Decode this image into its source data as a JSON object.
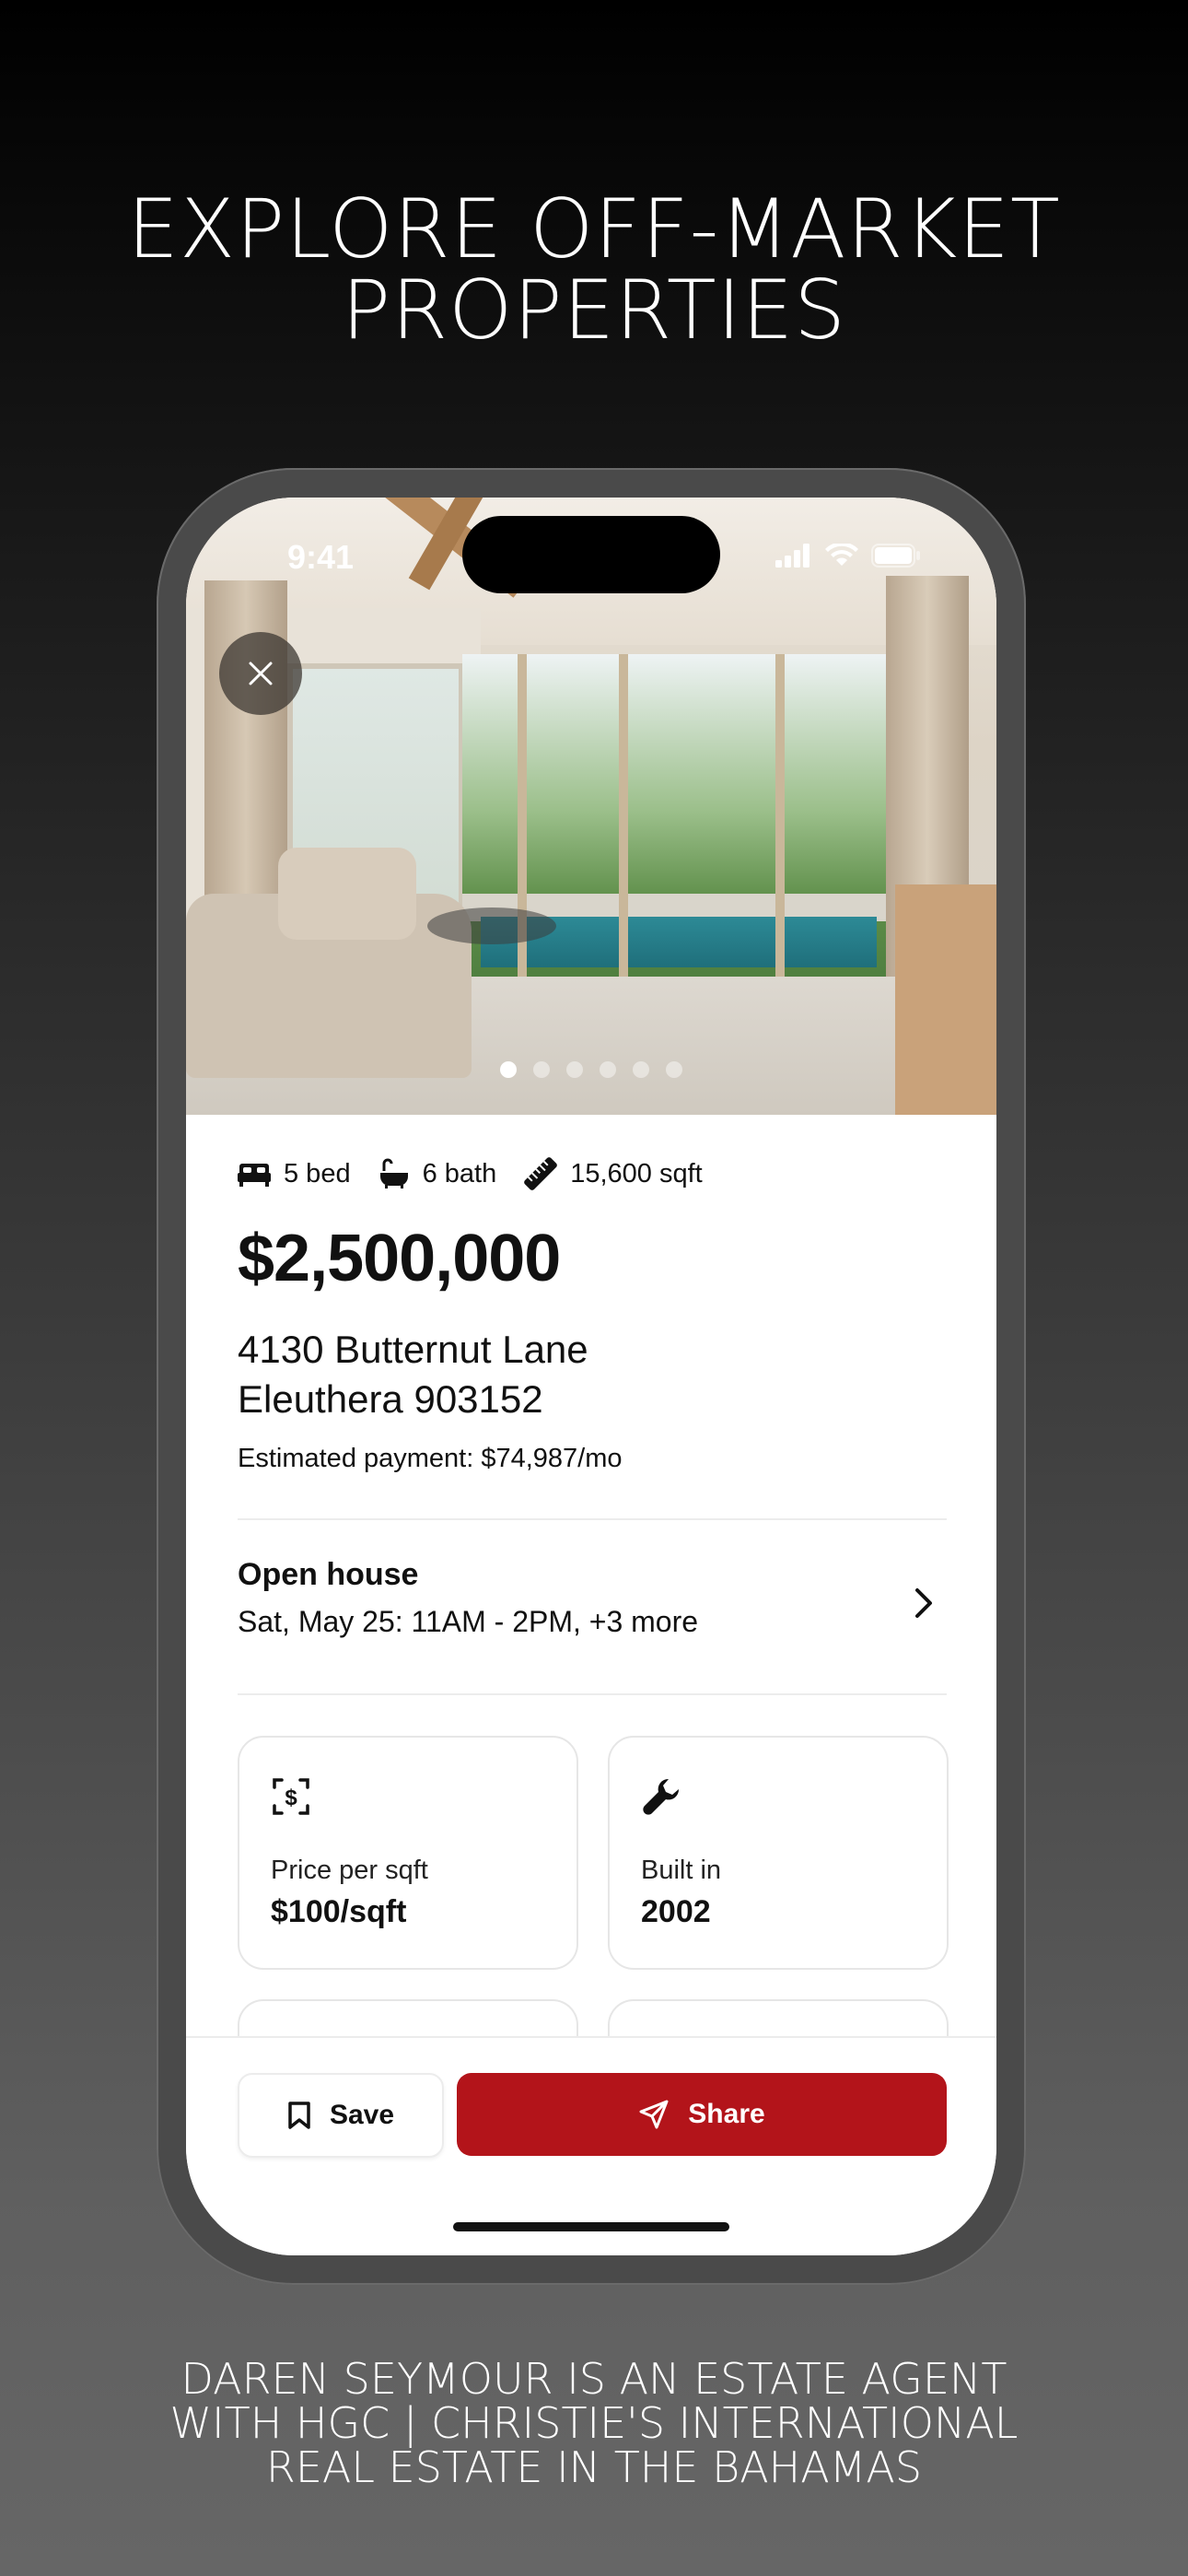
{
  "headline": {
    "line1": "EXPLORE OFF-MARKET",
    "line2": "PROPERTIES"
  },
  "status_bar": {
    "time": "9:41",
    "icons": [
      "signal-icon",
      "wifi-icon",
      "battery-icon"
    ]
  },
  "gallery": {
    "photo_count": 6,
    "active_index": 0,
    "close_icon": "close-icon"
  },
  "listing": {
    "beds": "5 bed",
    "baths": "6 bath",
    "sqft": "15,600 sqft",
    "price": "$2,500,000",
    "address_line1": "4130 Butternut Lane",
    "address_line2": "Eleuthera 903152",
    "estimated_payment": "Estimated payment: $74,987/mo"
  },
  "open_house": {
    "title": "Open house",
    "details": "Sat, May 25: 11AM - 2PM, +3 more"
  },
  "cards": [
    {
      "icon": "dollar-scan-icon",
      "label": "Price per sqft",
      "value": "$100/sqft"
    },
    {
      "icon": "wrench-icon",
      "label": "Built in",
      "value": "2002"
    }
  ],
  "actions": {
    "save_label": "Save",
    "share_label": "Share"
  },
  "footer": {
    "line1": "DAREN SEYMOUR IS AN ESTATE AGENT",
    "line2": "WITH HGC | CHRISTIE'S INTERNATIONAL",
    "line3": "REAL ESTATE IN THE BAHAMAS"
  },
  "colors": {
    "accent": "#b3141a",
    "text": "#111111"
  }
}
